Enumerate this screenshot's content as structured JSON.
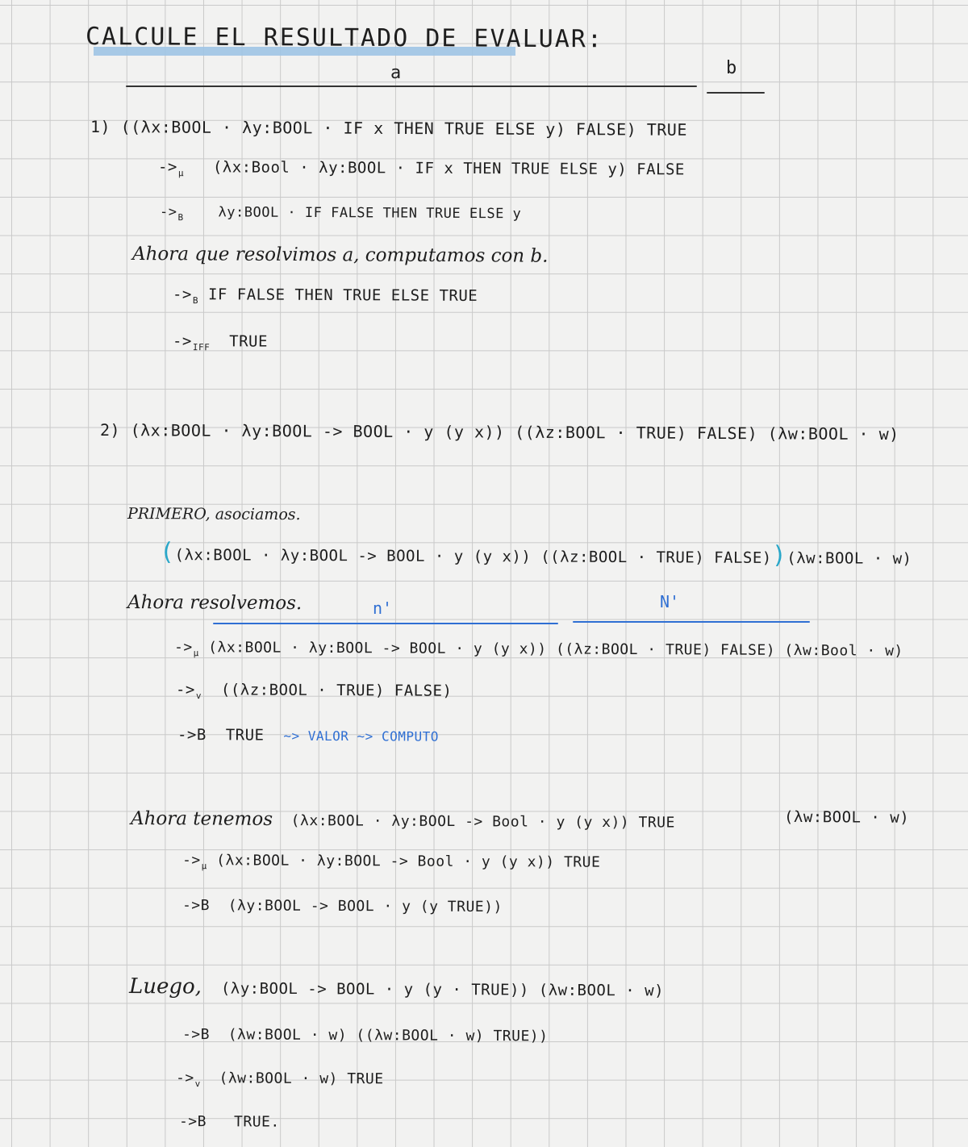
{
  "title": "CALCULE EL RESULTADO DE EVALUAR:",
  "ex1": {
    "label_a": "a",
    "label_b": "b",
    "expr": "1) ((λx:BOOL · λy:BOOL · IF x THEN TRUE ELSE y) FALSE) TRUE",
    "step1_arrow": "->",
    "step1_rule": "μ",
    "step1_expr": "(λx:Bool · λy:BOOL · IF x THEN TRUE ELSE y) FALSE",
    "step2_arrow": "->",
    "step2_rule": "B",
    "step2_expr": "λy:BOOL · IF FALSE THEN TRUE ELSE y",
    "note": "Ahora que resolvimos a, computamos con b.",
    "step3_arrow": "->",
    "step3_rule": "B",
    "step3_expr": "IF FALSE THEN TRUE ELSE TRUE",
    "step4_arrow": "->",
    "step4_rule": "IFF",
    "step4_expr": "TRUE"
  },
  "ex2": {
    "expr": "2) (λx:BOOL · λy:BOOL -> BOOL · y (y x)) ((λz:BOOL · TRUE) FALSE) (λw:BOOL · w)",
    "first_note": "PRIMERO, asociamos.",
    "assoc_open": "(",
    "assoc_mid": "(λx:BOOL · λy:BOOL -> BOOL · y (y x)) ((λz:BOOL · TRUE) FALSE)",
    "assoc_close": ")",
    "assoc_tail": "(λw:BOOL · w)",
    "resolve_note": "Ahora resolvemos.",
    "label_n1": "n'",
    "label_n2": "N'",
    "s1_arrow": "->",
    "s1_rule": "μ",
    "s1_expr": "(λx:BOOL · λy:BOOL -> BOOL · y (y x)) ((λz:BOOL · TRUE) FALSE)   (λw:Bool · w)",
    "s2_arrow": "->",
    "s2_rule": "v",
    "s2_expr": "((λz:BOOL · TRUE) FALSE)",
    "s3_arrow": "->",
    "s3_rule": "B",
    "s3_expr": "TRUE",
    "s3_note": "~> VALOR ~> COMPUTO",
    "tenemos_note": "Ahora tenemos",
    "t_expr": "(λx:BOOL · λy:BOOL -> Bool · y (y x)) TRUE",
    "t_tail": "(λw:BOOL · w)",
    "t1_arrow": "->",
    "t1_rule": "μ",
    "t1_expr": "(λx:BOOL · λy:BOOL -> Bool · y (y x)) TRUE",
    "t2_arrow": "->",
    "t2_rule": "B",
    "t2_expr": "(λy:BOOL -> BOOL · y (y TRUE))",
    "luego_note": "Luego,",
    "l_expr": "(λy:BOOL -> BOOL · y (y · TRUE))  (λw:BOOL · w)",
    "l1_arrow": "->",
    "l1_rule": "B",
    "l1_expr": "(λw:BOOL · w) ((λw:BOOL · w) TRUE))",
    "l2_arrow": "->",
    "l2_rule": "v",
    "l2_expr": "(λw:BOOL · w)  TRUE",
    "l3_arrow": "->",
    "l3_rule": "B",
    "l3_expr": "TRUE."
  }
}
